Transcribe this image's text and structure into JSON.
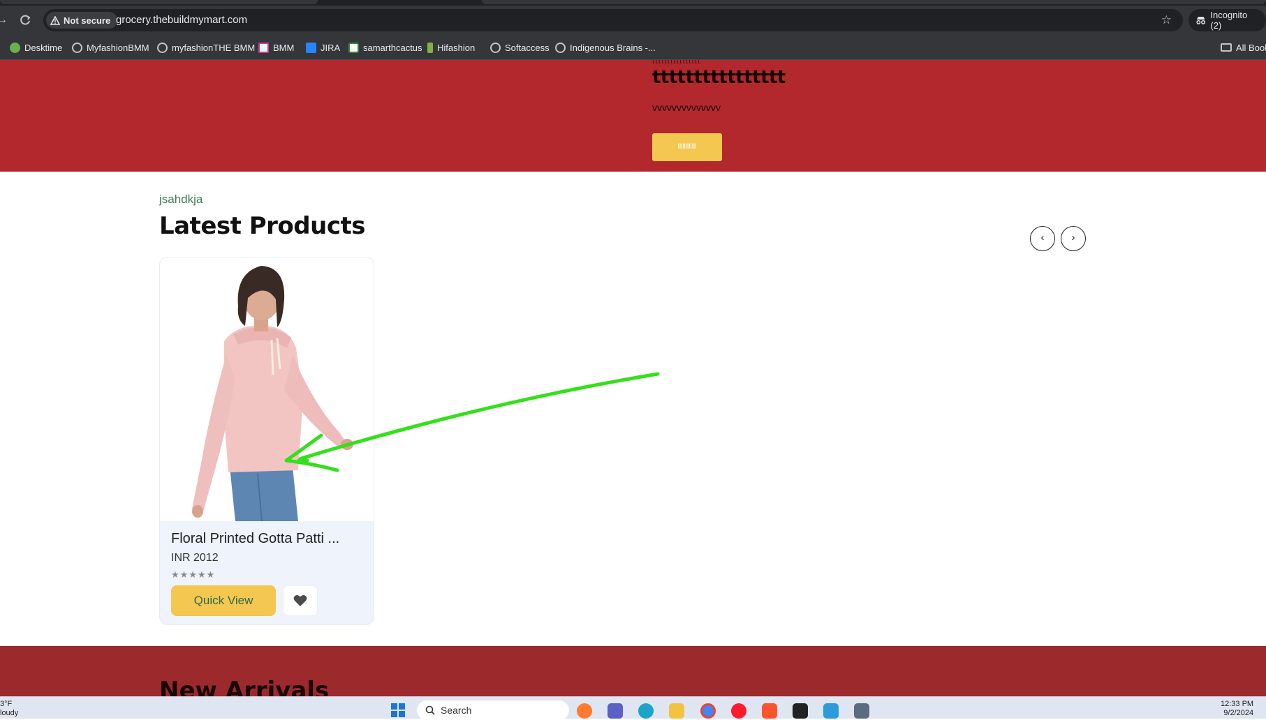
{
  "browser": {
    "security_chip": "Not secure",
    "url": "grocery.thebuildmymart.com",
    "incognito_label": "Incognito (2)",
    "bookmarks": [
      {
        "label": "Desktime",
        "icon": "desktime-icon"
      },
      {
        "label": "MyfashionBMM",
        "icon": "globe-icon"
      },
      {
        "label": "myfashionTHE BMM",
        "icon": "globe-icon"
      },
      {
        "label": "BMM",
        "icon": "bmm-icon"
      },
      {
        "label": "JIRA",
        "icon": "jira-icon"
      },
      {
        "label": "samarthcactus",
        "icon": "cactus-icon"
      },
      {
        "label": "Hifashion",
        "icon": "hifashion-icon"
      },
      {
        "label": "Softaccess",
        "icon": "globe-icon"
      },
      {
        "label": "Indigenous Brains -...",
        "icon": "globe-icon"
      }
    ],
    "all_bookmarks_label": "All Book"
  },
  "hero": {
    "cut_text": "tttttttttttttttt",
    "title": "tttttttttttttttt",
    "subtitle": "vvvvvvvvvvvvvv",
    "button_label": "llllllllllll",
    "background": "#b3282d",
    "button_color": "#f3c750"
  },
  "latest": {
    "kicker": "jsahdkja",
    "title": "Latest Products",
    "prev_label": "‹",
    "next_label": "›"
  },
  "products": [
    {
      "title": "Floral Printed Gotta Patti ...",
      "price": "INR 2012",
      "stars": "★★★★★",
      "quick_view_label": "Quick View"
    }
  ],
  "next_section": {
    "title": "New Arrivals",
    "background": "#9c2a2d"
  },
  "annotation": {
    "color": "#33e01a",
    "icon": "hand-drawn-arrow"
  },
  "taskbar": {
    "weather_line1": "3°F",
    "weather_line2": "loudy",
    "search_label": "Search",
    "time": "12:33 PM",
    "date": "9/2/2024"
  }
}
